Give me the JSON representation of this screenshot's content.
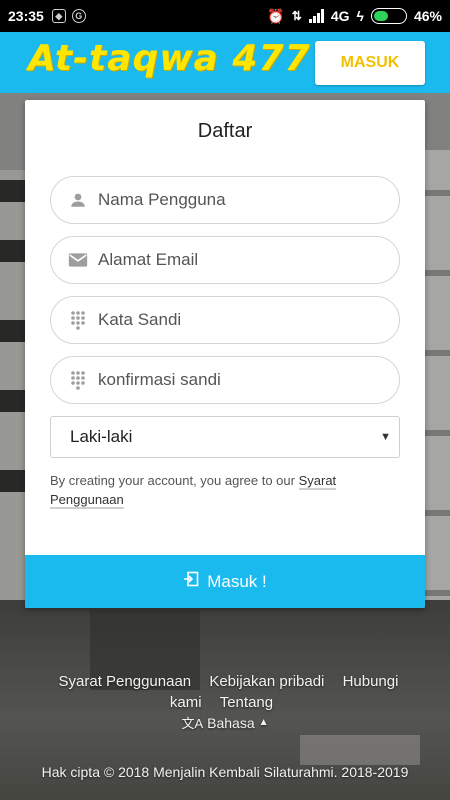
{
  "status_bar": {
    "time": "23:35",
    "network": "4G",
    "battery": "46%",
    "battery_level": 0.46,
    "notification_icons": [
      "shield-icon",
      "g-icon"
    ]
  },
  "header": {
    "logo": "At-taqwa 477",
    "login_label": "MASUK"
  },
  "form": {
    "title": "Daftar",
    "username_placeholder": "Nama Pengguna",
    "email_placeholder": "Alamat Email",
    "password_placeholder": "Kata Sandi",
    "confirm_placeholder": "konfirmasi sandi",
    "gender_selected": "Laki-laki",
    "terms_text": "By creating your account, you agree to our ",
    "terms_link": "Syarat Penggunaan",
    "submit_label": "Masuk !"
  },
  "footer": {
    "links": [
      "Syarat Penggunaan",
      "Kebijakan pribadi",
      "Hubungi kami",
      "Tentang"
    ],
    "language_label": "Bahasa",
    "copyright": "Hak cipta © 2018 Menjalin Kembali Silaturahmi. 2018-2019"
  },
  "colors": {
    "accent": "#1ab9ee",
    "logo": "#ffe600",
    "login_text": "#f2c100"
  }
}
